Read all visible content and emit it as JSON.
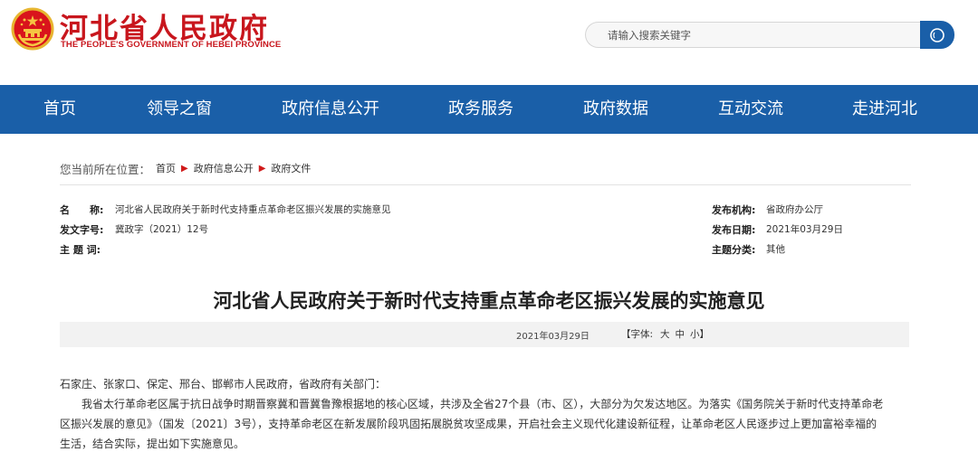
{
  "header": {
    "title": "河北省人民政府",
    "subtitle": "THE PEOPLE'S GOVERNMENT OF HEBEI PROVINCE",
    "emblem_icon": "national-emblem-icon",
    "brand_color": "#c8161d"
  },
  "search": {
    "placeholder": "请输入搜索关键字",
    "button_icon": "search-icon"
  },
  "nav": {
    "items": [
      "首页",
      "领导之窗",
      "政府信息公开",
      "政务服务",
      "政府数据",
      "互动交流",
      "走进河北"
    ],
    "background": "#1a5fa8"
  },
  "breadcrumb": {
    "prefix": "您当前所在位置：",
    "items": [
      "首页",
      "政府信息公开",
      "政府文件"
    ],
    "separator_icon": "triangle-right-icon"
  },
  "meta": {
    "name_label": "名　　称:",
    "name_value": "河北省人民政府关于新时代支持重点革命老区振兴发展的实施意见",
    "doc_no_label": "发文字号:",
    "doc_no_value": "冀政字（2021）12号",
    "keywords_label": "主 题 词:",
    "keywords_value": "",
    "issuer_label": "发布机构:",
    "issuer_value": "省政府办公厅",
    "date_label": "发布日期:",
    "date_value": "2021年03月29日",
    "category_label": "主题分类:",
    "category_value": "其他"
  },
  "article": {
    "title": "河北省人民政府关于新时代支持重点革命老区振兴发展的实施意见",
    "date": "2021年03月29日",
    "font_prefix": "【字体:",
    "font_sizes": [
      "大",
      "中",
      "小"
    ],
    "font_suffix": "】",
    "addressee": "石家庄、张家口、保定、邢台、邯郸市人民政府，省政府有关部门：",
    "lines": [
      "我省太行革命老区属于抗日战争时期晋察冀和晋冀鲁豫根据地的核心区域，共涉及全省27个县（市、区），大部分为欠发达地区。为落实《国务院关于新时代支持革命老",
      "区振兴发展的意见》（国发〔2021〕3号），支持革命老区在新发展阶段巩固拓展脱贫攻坚成果，开启社会主义现代化建设新征程，让革命老区人民逐步过上更加富裕幸福的",
      "生活，结合实际，提出如下实施意见。"
    ]
  }
}
